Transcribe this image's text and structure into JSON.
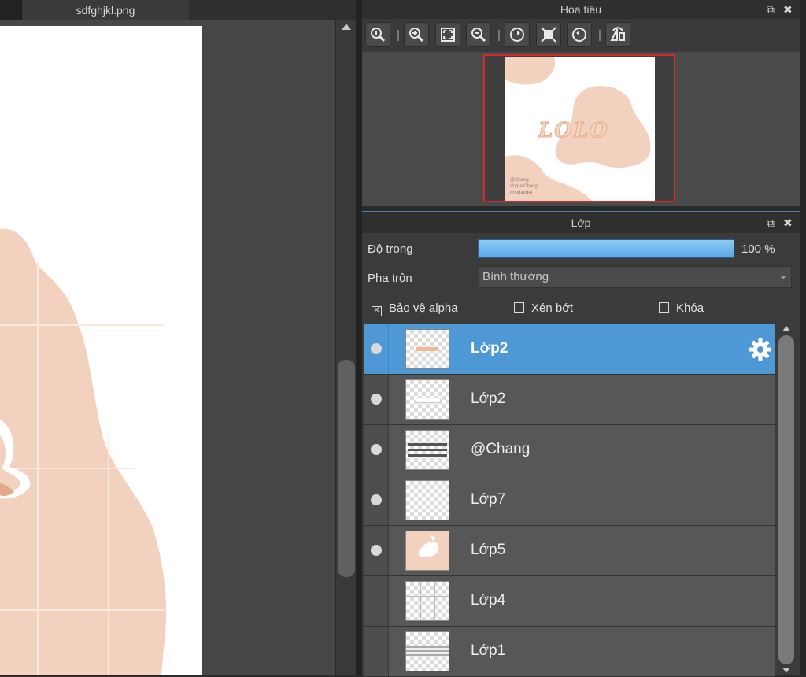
{
  "document": {
    "tab_title": "sdfghjkl.png"
  },
  "navigator": {
    "title": "Hoa tiêu",
    "tools": [
      "zoom-actual-icon",
      "zoom-in-icon",
      "fit-screen-icon",
      "zoom-out-icon",
      "rotate-left-icon",
      "fit-window-icon",
      "rotate-right-icon",
      "flip-horizontal-icon"
    ],
    "preview": {
      "title_text": "LOLO",
      "credit_text": "@Chang VuquaChang #hodapdel"
    }
  },
  "layers_panel": {
    "title": "Lớp",
    "opacity_label": "Độ trong",
    "opacity_value": "100 %",
    "opacity_fraction": 1.0,
    "blend_label": "Pha trộn",
    "blend_value": "Bình thường",
    "protect_alpha_label": "Bảo vệ alpha",
    "protect_alpha_checked": true,
    "clipping_label": "Xén bớt",
    "clipping_checked": false,
    "lock_label": "Khóa",
    "lock_checked": false,
    "layers": [
      {
        "name": "Lớp2",
        "visible": true,
        "selected": true
      },
      {
        "name": "Lớp2",
        "visible": true,
        "selected": false
      },
      {
        "name": "@Chang",
        "visible": true,
        "selected": false
      },
      {
        "name": "Lớp7",
        "visible": true,
        "selected": false
      },
      {
        "name": "Lớp5",
        "visible": true,
        "selected": false
      },
      {
        "name": "Lớp4",
        "visible": false,
        "selected": false
      },
      {
        "name": "Lớp1",
        "visible": false,
        "selected": false
      }
    ]
  },
  "colors": {
    "selection": "#4f98d6",
    "opacity_bar": "#6fb7ee",
    "preview_border": "#d42a2a",
    "artwork_peach": "#f2d2bf"
  }
}
